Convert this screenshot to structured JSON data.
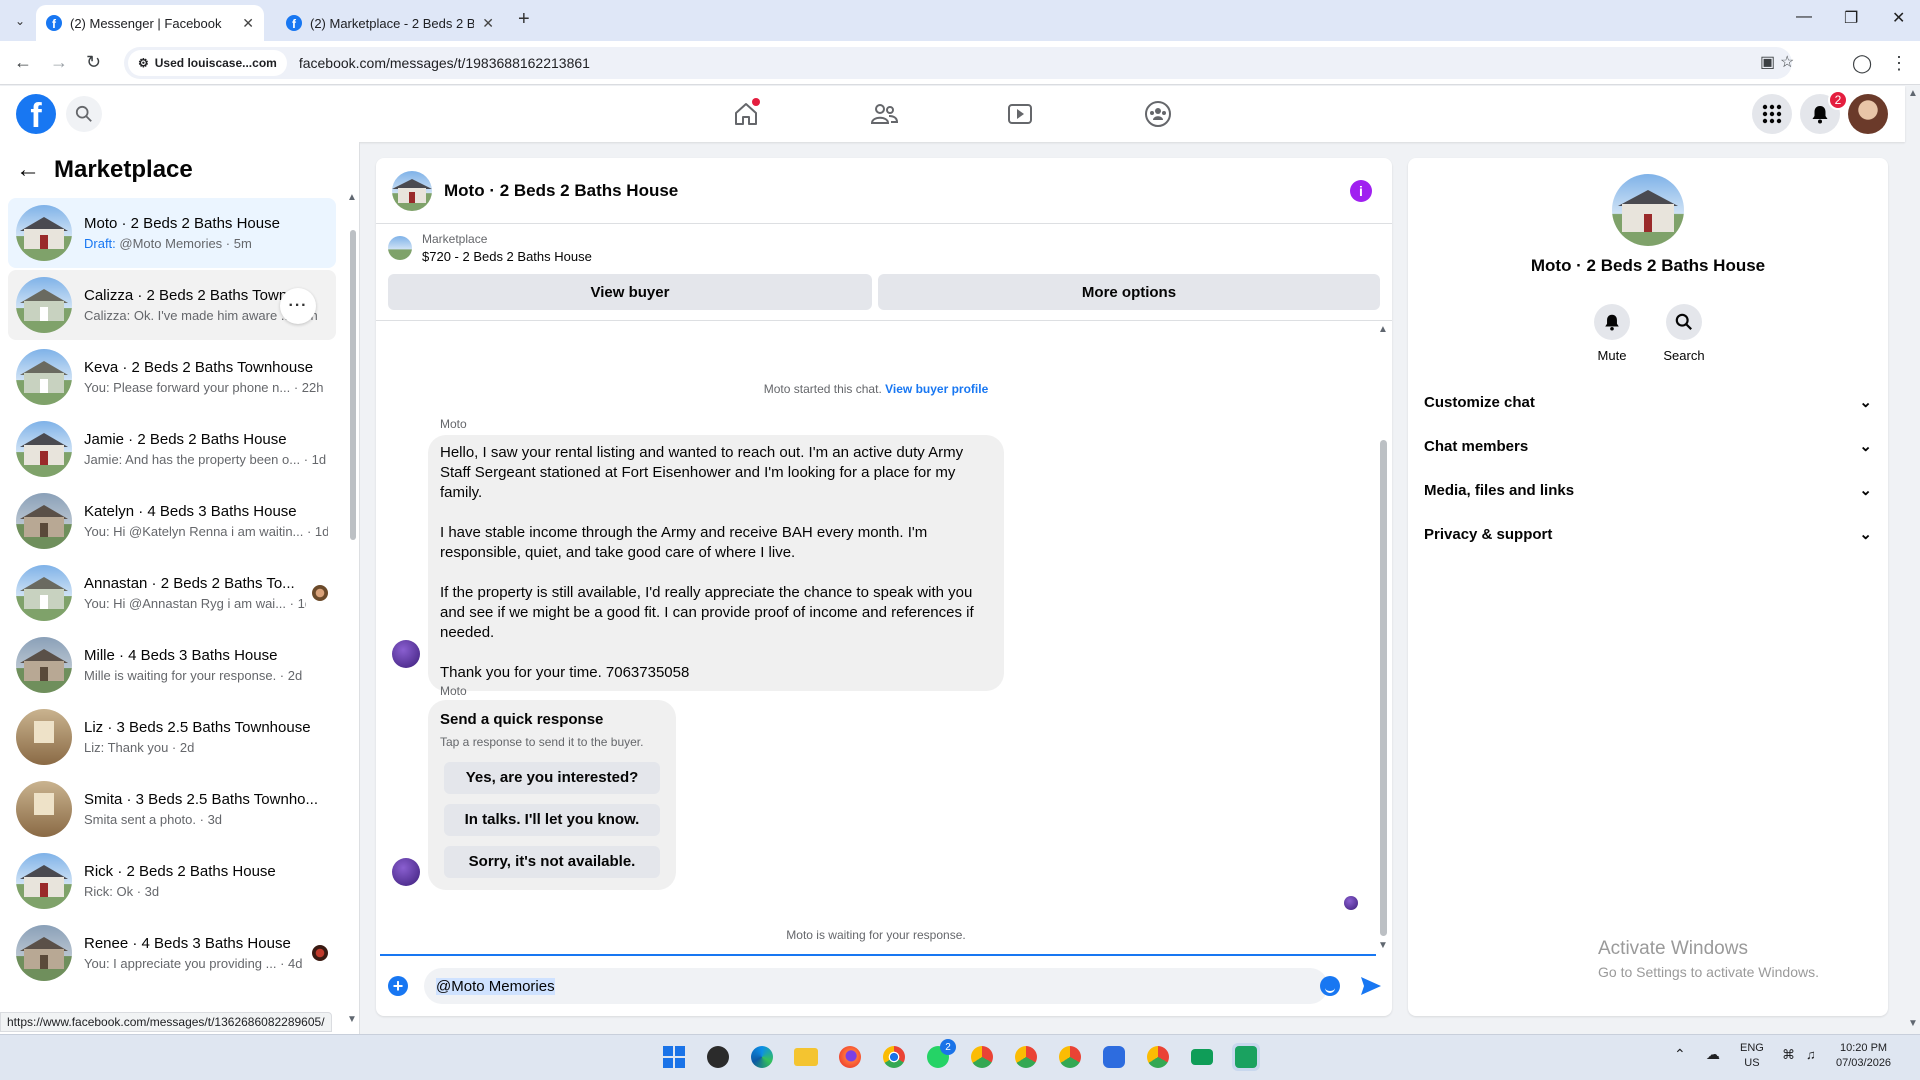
{
  "browser": {
    "tabs": [
      {
        "title": "(2) Messenger | Facebook",
        "active": true
      },
      {
        "title": "(2) Marketplace - 2 Beds 2 Baths",
        "active": false
      }
    ],
    "site_chip": "Used louiscase...com",
    "url": "facebook.com/messages/t/1983688162213861",
    "status_url": "https://www.facebook.com/messages/t/1362686082289605/"
  },
  "fb_header": {
    "logo": "f",
    "notification_count": "2",
    "icons": [
      "search-icon",
      "home-icon",
      "friends-icon",
      "watch-icon",
      "groups-icon",
      "menu-grid-icon",
      "bell-icon"
    ]
  },
  "sidebar": {
    "title": "Marketplace",
    "conversations": [
      {
        "name": "Moto · 2 Beds 2 Baths House",
        "draft": "Draft:",
        "preview": " @Moto Memories · 5m",
        "thumb": "exterior"
      },
      {
        "name": "Calizza · 2 Beds 2 Baths Town...",
        "preview": "Calizza: Ok. I've made him aware ... · 5h",
        "thumb": "exterior"
      },
      {
        "name": "Keva · 2 Beds 2 Baths Townhouse",
        "preview": "You: Please forward your phone n... · 22h",
        "thumb": "exterior"
      },
      {
        "name": "Jamie · 2 Beds 2 Baths House",
        "preview": "Jamie: And has the property been o... · 1d",
        "thumb": "exterior"
      },
      {
        "name": "Katelyn · 4 Beds 3 Baths House",
        "preview": "You: Hi @Katelyn Renna i am waitin... · 1d",
        "thumb": "exterior"
      },
      {
        "name": "Annastan · 2 Beds 2 Baths To...",
        "preview": "You: Hi @Annastan Ryg i am wai... · 1d",
        "thumb": "exterior"
      },
      {
        "name": "Mille · 4 Beds 3 Baths House",
        "preview": "Mille is waiting for your response. · 2d",
        "thumb": "exterior"
      },
      {
        "name": "Liz · 3 Beds 2.5 Baths Townhouse",
        "preview": "Liz: Thank you · 2d",
        "thumb": "interior"
      },
      {
        "name": "Smita · 3 Beds 2.5 Baths Townho...",
        "preview": "Smita sent a photo. · 3d",
        "thumb": "interior"
      },
      {
        "name": "Rick · 2 Beds 2 Baths House",
        "preview": "Rick: Ok · 3d",
        "thumb": "exterior"
      },
      {
        "name": "Renee · 4 Beds 3 Baths House",
        "preview": "You: I appreciate you providing ... · 4d",
        "thumb": "exterior"
      }
    ]
  },
  "chat": {
    "title": "Moto · 2 Beds 2 Baths House",
    "marketplace_label": "Marketplace",
    "listing": "$720 - 2 Beds 2 Baths House",
    "view_buyer": "View buyer",
    "more_options": "More options",
    "started_text": "Moto started this chat.",
    "view_buyer_profile": "View buyer profile",
    "sender": "Moto",
    "message_paragraphs": [
      "Hello, I saw your rental listing and wanted to reach out. I'm an active duty Army Staff Sergeant stationed at Fort Eisenhower and I'm looking for a place for my family.",
      "I have stable income through the Army and receive BAH every month. I'm responsible, quiet, and take good care of where I live.",
      "If the property is still available, I'd really appreciate the chance to speak with you and see if we might be a good fit. I can provide proof of income and references if needed.",
      "Thank you for your time. 7063735058"
    ],
    "quick_response": {
      "sender": "Moto",
      "title": "Send a quick response",
      "subtitle": "Tap a response to send it to the buyer.",
      "options": [
        "Yes, are you interested?",
        "In talks. I'll let you know.",
        "Sorry, it's not available."
      ]
    },
    "waiting_text": "Moto is waiting for your response.",
    "compose_value": "@Moto Memories"
  },
  "info_panel": {
    "name": "Moto · 2 Beds 2 Baths House",
    "actions": [
      {
        "label": "Mute",
        "icon": "bell-icon"
      },
      {
        "label": "Search",
        "icon": "search-icon"
      }
    ],
    "sections": [
      "Customize chat",
      "Chat members",
      "Media, files and links",
      "Privacy & support"
    ],
    "watermark_title": "Activate Windows",
    "watermark_sub": "Go to Settings to activate Windows."
  },
  "taskbar": {
    "whatsapp_badge": "2",
    "lang_1": "ENG",
    "lang_2": "US",
    "time": "10:20 PM",
    "date": "07/03/2026"
  },
  "colors": {
    "fb_blue": "#1877f2",
    "selected_bg": "#ebf5ff",
    "bubble_bg": "#f0f0f0",
    "info_purple": "#a020f0",
    "badge_red": "#e41e3f"
  }
}
